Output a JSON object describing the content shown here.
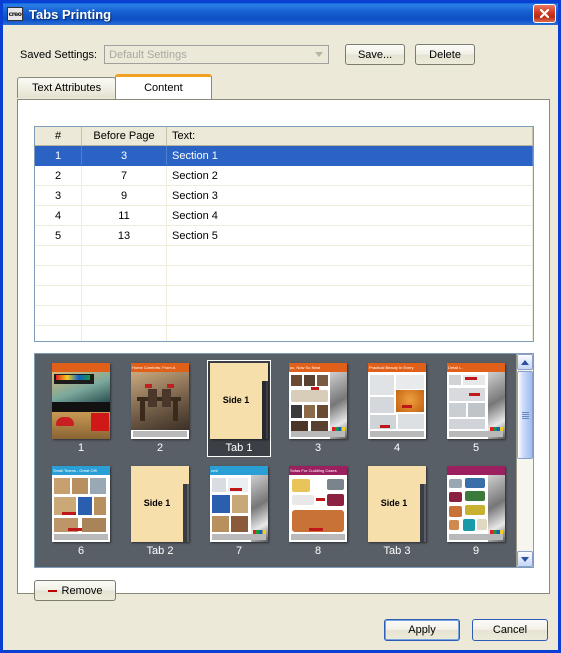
{
  "window": {
    "title": "Tabs Printing",
    "app_icon": "creo-logo-icon",
    "close_label": "✕"
  },
  "saved_settings": {
    "label": "Saved Settings:",
    "value": "Default Settings",
    "disabled": true,
    "save_label": "Save...",
    "delete_label": "Delete"
  },
  "tabs": [
    {
      "label": "Text Attributes",
      "active": false
    },
    {
      "label": "Content",
      "active": true
    }
  ],
  "table": {
    "columns": [
      "#",
      "Before Page",
      "Text:"
    ],
    "rows": [
      {
        "num": "1",
        "page": "3",
        "text": "Section 1",
        "selected": true
      },
      {
        "num": "2",
        "page": "7",
        "text": "Section 2",
        "selected": false
      },
      {
        "num": "3",
        "page": "9",
        "text": "Section 3",
        "selected": false
      },
      {
        "num": "4",
        "page": "11",
        "text": "Section 4",
        "selected": false
      },
      {
        "num": "5",
        "page": "13",
        "text": "Section 5",
        "selected": false
      }
    ],
    "empty_rows": 6
  },
  "preview": {
    "background_color": "#595f66",
    "row1": [
      {
        "label": "1",
        "kind": "page",
        "selected": false,
        "banner_color": "#e0601a",
        "banner_text": "",
        "theme": "retro-diner"
      },
      {
        "label": "2",
        "kind": "page",
        "selected": false,
        "banner_color": "#e0601a",
        "banner_text": "Home Comforts: From A",
        "theme": "dining-room"
      },
      {
        "label": "Tab 1",
        "kind": "tab",
        "selected": true,
        "side_text": "Side 1"
      },
      {
        "label": "3",
        "kind": "page",
        "selected": false,
        "banner_color": "#e0601a",
        "banner_text": "ac, Now So Neat",
        "theme": "furniture-grid"
      },
      {
        "label": "4",
        "kind": "page",
        "selected": false,
        "banner_color": "#e0601a",
        "banner_text": "Practical Beauty In Every",
        "theme": "kitchenware"
      },
      {
        "label": "5",
        "kind": "page",
        "selected": false,
        "banner_color": "#e0601a",
        "banner_text": "Detail L.",
        "theme": "appliances"
      }
    ],
    "row2": [
      {
        "label": "6",
        "kind": "page",
        "selected": false,
        "banner_color": "#2a9fd6",
        "banner_text": "Small Teams - Great Offi",
        "theme": "office-desks"
      },
      {
        "label": "Tab 2",
        "kind": "tab",
        "selected": false,
        "side_text": "Side 1"
      },
      {
        "label": "7",
        "kind": "page",
        "selected": false,
        "banner_color": "#2a9fd6",
        "banner_text": "ces!",
        "theme": "office-storage"
      },
      {
        "label": "8",
        "kind": "page",
        "selected": false,
        "banner_color": "#9c2060",
        "banner_text": "Sofas For Cuddling Cases",
        "theme": "sofas"
      },
      {
        "label": "Tab 3",
        "kind": "tab",
        "selected": false,
        "side_text": "Side 1"
      },
      {
        "label": "9",
        "kind": "page",
        "selected": false,
        "banner_color": "#9c2060",
        "banner_text": "",
        "theme": "sofas-color"
      }
    ],
    "scrollbar": {
      "up": "▲",
      "down": "▼"
    }
  },
  "remove_button": {
    "label": "Remove",
    "icon": "minus-icon"
  },
  "footer": {
    "apply_label": "Apply",
    "cancel_label": "Cancel"
  }
}
